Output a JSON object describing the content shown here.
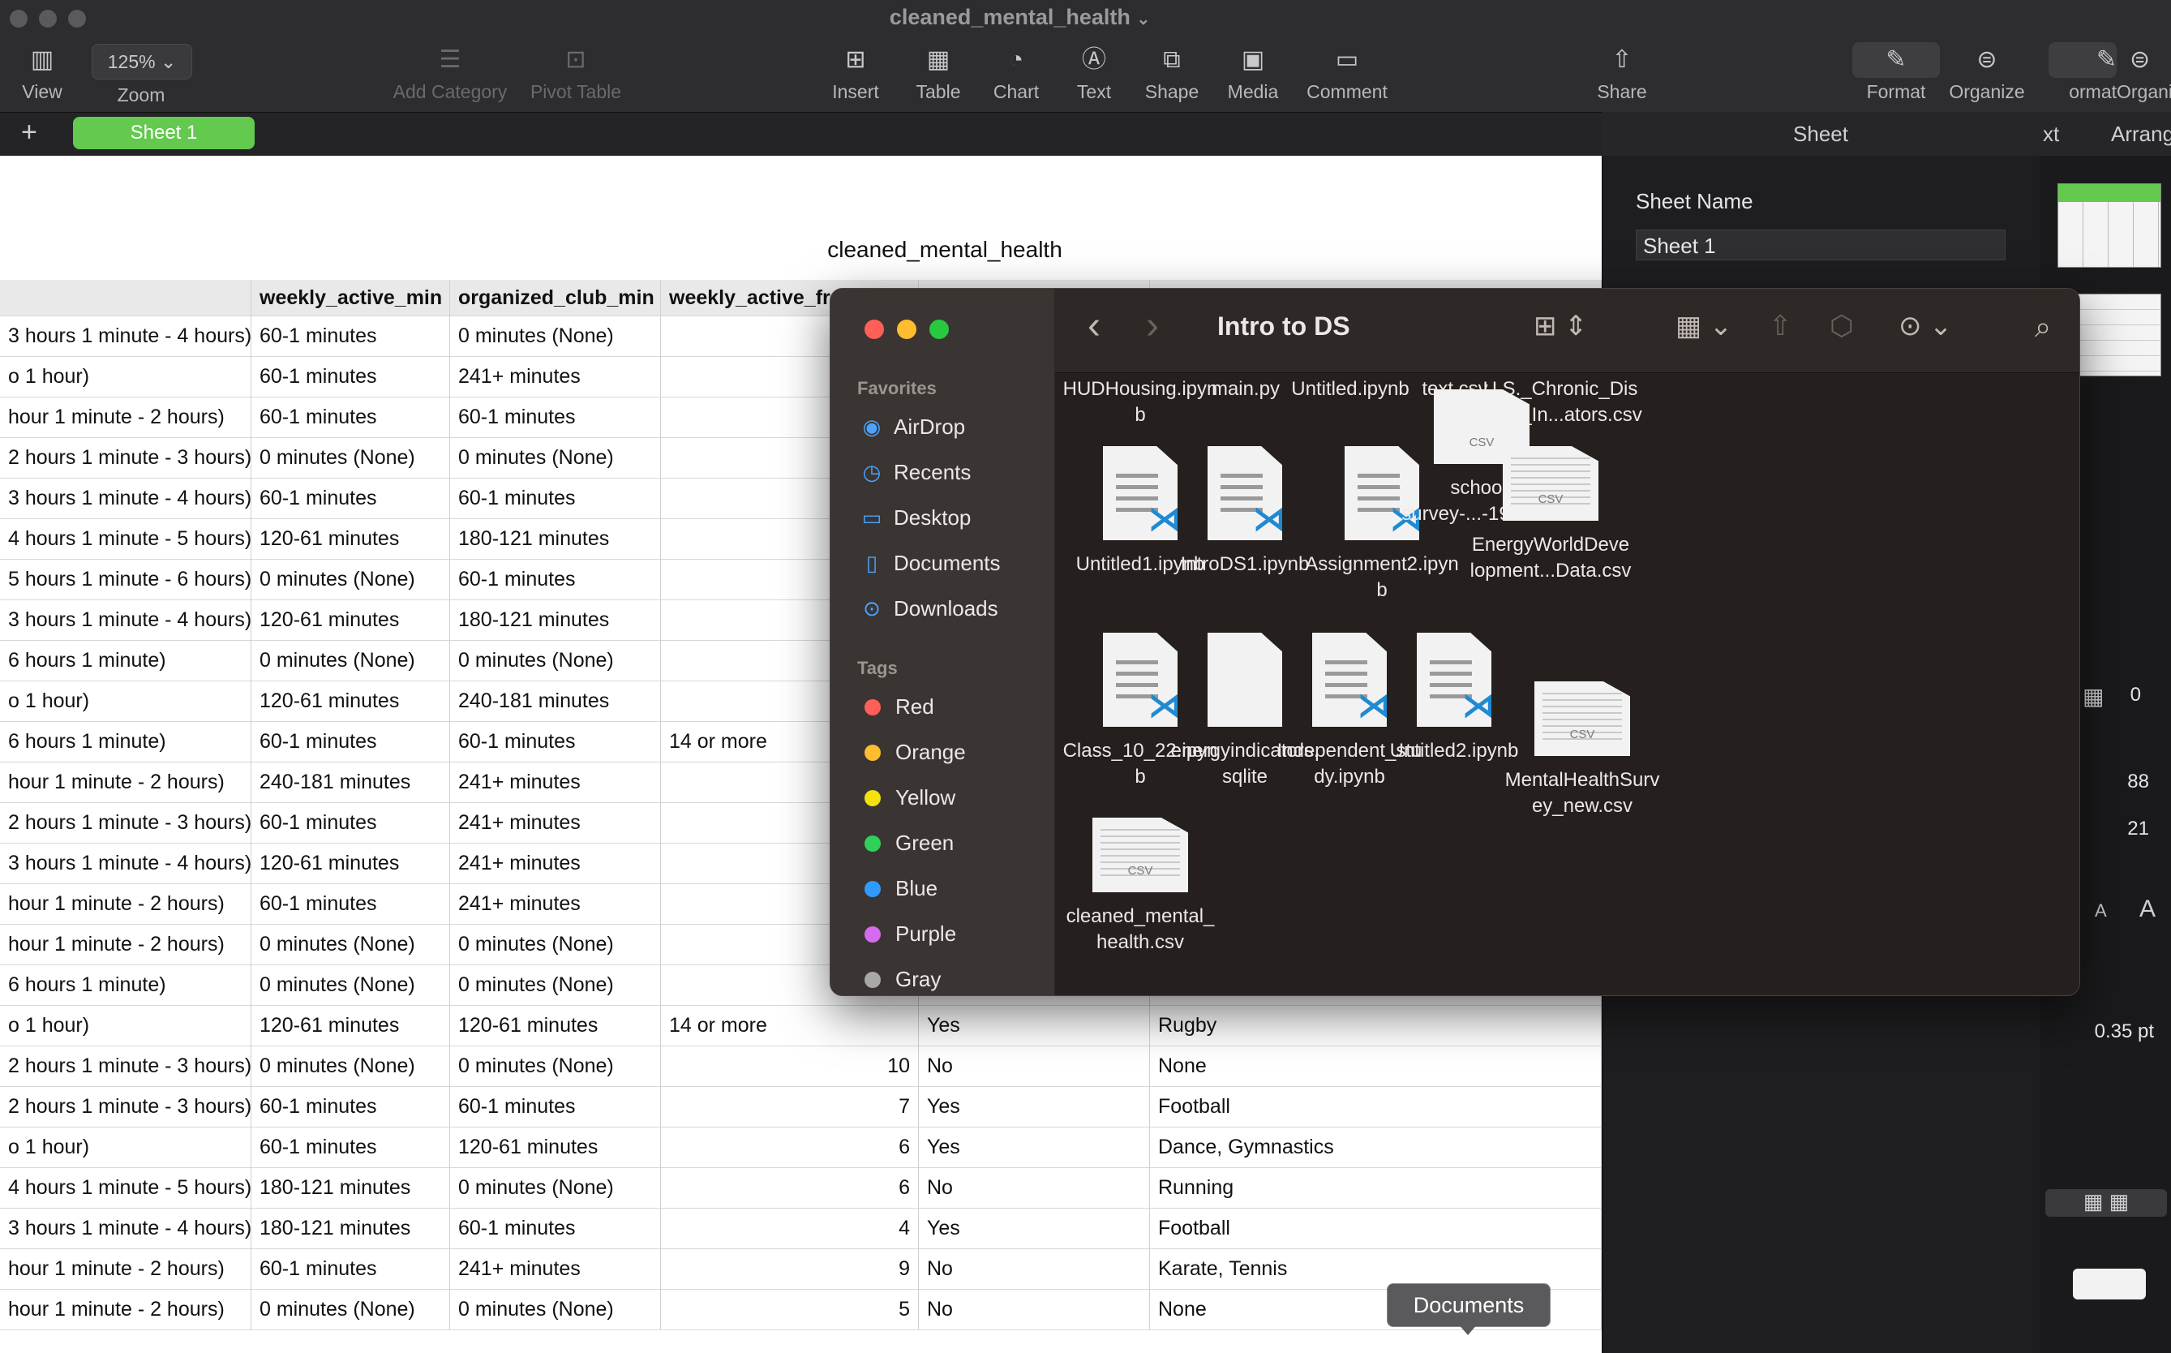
{
  "window": {
    "title": "cleaned_mental_health",
    "title_chevron": "⌄"
  },
  "toolbar": {
    "view": "View",
    "zoom_value": "125%",
    "zoom": "Zoom",
    "add_category": "Add Category",
    "pivot_table": "Pivot Table",
    "insert": "Insert",
    "table": "Table",
    "chart": "Chart",
    "text": "Text",
    "shape": "Shape",
    "media": "Media",
    "comment": "Comment",
    "share": "Share",
    "format": "Format",
    "organize": "Organize",
    "format_cut": "ormat",
    "organize_cut": "Organi"
  },
  "sheet_tabs": {
    "add": "+",
    "active": "Sheet 1"
  },
  "table": {
    "title": "cleaned_mental_health",
    "headers": [
      "",
      "weekly_active_min",
      "organized_club_min",
      "weekly_active_fre",
      "",
      ""
    ],
    "rows": [
      [
        "3 hours 1 minute - 4 hours)",
        "60-1 minutes",
        "0 minutes (None)",
        "",
        "",
        ""
      ],
      [
        "o 1 hour)",
        "60-1 minutes",
        "241+ minutes",
        "",
        "",
        ""
      ],
      [
        "hour 1 minute - 2 hours)",
        "60-1 minutes",
        "60-1 minutes",
        "",
        "",
        ""
      ],
      [
        "2 hours 1 minute - 3 hours)",
        "0 minutes (None)",
        "0 minutes (None)",
        "",
        "",
        ""
      ],
      [
        "3 hours 1 minute - 4 hours)",
        "60-1 minutes",
        "60-1 minutes",
        "",
        "",
        ""
      ],
      [
        "4 hours 1 minute - 5 hours)",
        "120-61 minutes",
        "180-121 minutes",
        "",
        "",
        ""
      ],
      [
        "5 hours 1 minute - 6 hours)",
        "0 minutes (None)",
        "60-1 minutes",
        "",
        "",
        ""
      ],
      [
        "3 hours 1 minute - 4 hours)",
        "120-61 minutes",
        "180-121 minutes",
        "",
        "",
        ""
      ],
      [
        "6 hours 1 minute)",
        "0 minutes (None)",
        "0 minutes (None)",
        "",
        "",
        ""
      ],
      [
        "o 1 hour)",
        "120-61 minutes",
        "240-181 minutes",
        "",
        "",
        ""
      ],
      [
        "6 hours 1 minute)",
        "60-1 minutes",
        "60-1 minutes",
        "14 or more",
        "",
        ""
      ],
      [
        "hour 1 minute - 2 hours)",
        "240-181 minutes",
        "241+ minutes",
        "",
        "",
        ""
      ],
      [
        "2 hours 1 minute - 3 hours)",
        "60-1 minutes",
        "241+ minutes",
        "",
        "",
        ""
      ],
      [
        "3 hours 1 minute - 4 hours)",
        "120-61 minutes",
        "241+ minutes",
        "",
        "",
        ""
      ],
      [
        "hour 1 minute - 2 hours)",
        "60-1 minutes",
        "241+ minutes",
        "",
        "",
        ""
      ],
      [
        "hour 1 minute - 2 hours)",
        "0 minutes (None)",
        "0 minutes (None)",
        "",
        "",
        ""
      ],
      [
        "6 hours 1 minute)",
        "0 minutes (None)",
        "0 minutes (None)",
        "",
        "",
        ""
      ],
      [
        "o 1 hour)",
        "120-61 minutes",
        "120-61 minutes",
        "14 or more",
        "Yes",
        "Rugby"
      ],
      [
        "2 hours 1 minute - 3 hours)",
        "0 minutes (None)",
        "0 minutes (None)",
        "10",
        "No",
        "None"
      ],
      [
        "2 hours 1 minute - 3 hours)",
        "60-1 minutes",
        "60-1 minutes",
        "7",
        "Yes",
        "Football"
      ],
      [
        "o 1 hour)",
        "60-1 minutes",
        "120-61 minutes",
        "6",
        "Yes",
        "Dance, Gymnastics"
      ],
      [
        "4 hours 1 minute - 5 hours)",
        "180-121 minutes",
        "0 minutes (None)",
        "6",
        "No",
        "Running"
      ],
      [
        "3 hours 1 minute - 4 hours)",
        "180-121 minutes",
        "60-1 minutes",
        "4",
        "Yes",
        "Football"
      ],
      [
        "hour 1 minute - 2 hours)",
        "60-1 minutes",
        "241+ minutes",
        "9",
        "No",
        "Karate, Tennis"
      ],
      [
        "hour 1 minute - 2 hours)",
        "0 minutes (None)",
        "0 minutes (None)",
        "5",
        "No",
        "None"
      ]
    ]
  },
  "inspector": {
    "tab": "Sheet",
    "sheet_name_label": "Sheet Name",
    "sheet_name_value": "Sheet 1"
  },
  "right_strip": {
    "tab_text": "xt",
    "tab_arrange": "Arrang",
    "val_0": "0",
    "val_88": "88",
    "val_21": "21",
    "small_a": "A",
    "big_a": "A",
    "pt": "0.35 pt"
  },
  "finder": {
    "title": "Intro to DS",
    "favorites_header": "Favorites",
    "favorites": [
      {
        "label": "AirDrop",
        "icon": "airdrop-icon",
        "glyph": "◉"
      },
      {
        "label": "Recents",
        "icon": "clock-icon",
        "glyph": "◷"
      },
      {
        "label": "Desktop",
        "icon": "desktop-icon",
        "glyph": "▭"
      },
      {
        "label": "Documents",
        "icon": "document-icon",
        "glyph": "▯"
      },
      {
        "label": "Downloads",
        "icon": "download-icon",
        "glyph": "⊙"
      }
    ],
    "tags_header": "Tags",
    "tags": [
      {
        "label": "Red",
        "color": "#ff5f57"
      },
      {
        "label": "Orange",
        "color": "#febc2e"
      },
      {
        "label": "Yellow",
        "color": "#f5e10d"
      },
      {
        "label": "Green",
        "color": "#30d158"
      },
      {
        "label": "Blue",
        "color": "#2f9bff"
      },
      {
        "label": "Purple",
        "color": "#d66bf2"
      },
      {
        "label": "Gray",
        "color": "#a8a8a8"
      }
    ],
    "top_files": [
      {
        "l1": "HUDHousing.ipyn",
        "l2": "b"
      },
      {
        "l1": "main.py",
        "l2": ""
      },
      {
        "l1": "Untitled.ipynb",
        "l2": ""
      },
      {
        "l1": "text.csv",
        "l2": ""
      },
      {
        "l1": "U.S._Chronic_Dis",
        "l2": "ease_In...ators.csv"
      }
    ],
    "files": [
      {
        "l1": "Untitled1.ipynb",
        "l2": "",
        "kind": "ipynb"
      },
      {
        "l1": "IntroDS1.ipynb",
        "l2": "",
        "kind": "ipynb"
      },
      {
        "l1": "Assignment2.ipyn",
        "l2": "b",
        "kind": "ipynb"
      },
      {
        "l1": "school-",
        "l2": "survey-...-19-1.csv",
        "kind": "csv"
      },
      {
        "l1": "EnergyWorldDeve",
        "l2": "lopment...Data.csv",
        "kind": "sheet"
      },
      {
        "l1": "Class_10_22.ipyn",
        "l2": "b",
        "kind": "ipynb"
      },
      {
        "l1": "energyindicators.",
        "l2": "sqlite",
        "kind": "blank"
      },
      {
        "l1": "Independent_stu",
        "l2": "dy.ipynb",
        "kind": "ipynb"
      },
      {
        "l1": "Untitled2.ipynb",
        "l2": "",
        "kind": "ipynb"
      },
      {
        "l1": "MentalHealthSurv",
        "l2": "ey_new.csv",
        "kind": "sheet"
      },
      {
        "l1": "cleaned_mental_",
        "l2": "health.csv",
        "kind": "sheet"
      }
    ],
    "csv_badge": "CSV",
    "vscode_badge": "⋊"
  },
  "tooltip": {
    "text": "Documents"
  },
  "icons": {
    "back": "‹",
    "forward": "›",
    "grid": "⊞",
    "group": "⊞",
    "share": "⇧",
    "tag": "⌂",
    "more": "⊙",
    "search": "⌕"
  }
}
